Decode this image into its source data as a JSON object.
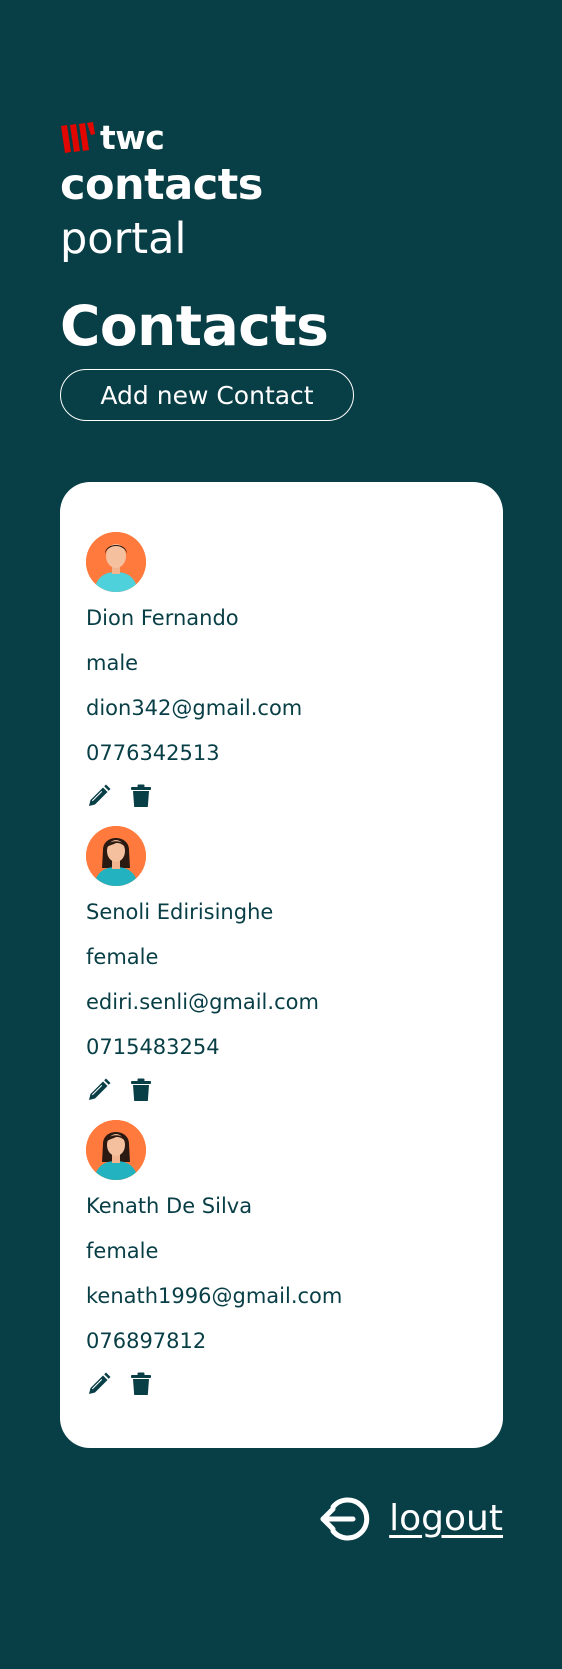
{
  "brand": {
    "logo_icon": "twc-logo-icon",
    "logo_text": "twc",
    "logo_color": "#e10600"
  },
  "app_title": {
    "line1": "contacts",
    "line2": "portal"
  },
  "page": {
    "title": "Contacts",
    "add_button_label": "Add new Contact"
  },
  "colors": {
    "background": "#083e45",
    "card": "#ffffff",
    "text_on_card": "#083e45",
    "avatar_bg": "#ff7a3c"
  },
  "contacts": [
    {
      "avatar": "male-avatar-icon",
      "name": "Dion Fernando",
      "gender": "male",
      "email": "dion342@gmail.com",
      "phone": "0776342513"
    },
    {
      "avatar": "female-avatar-icon",
      "name": "Senoli Edirisinghe",
      "gender": "female",
      "email": "ediri.senli@gmail.com",
      "phone": "0715483254"
    },
    {
      "avatar": "female-avatar-icon",
      "name": "Kenath De Silva",
      "gender": "female",
      "email": "kenath1996@gmail.com",
      "phone": "076897812"
    }
  ],
  "row_actions": {
    "edit_icon": "pencil-icon",
    "delete_icon": "trash-icon"
  },
  "logout": {
    "icon": "logout-icon",
    "label": "logout"
  }
}
